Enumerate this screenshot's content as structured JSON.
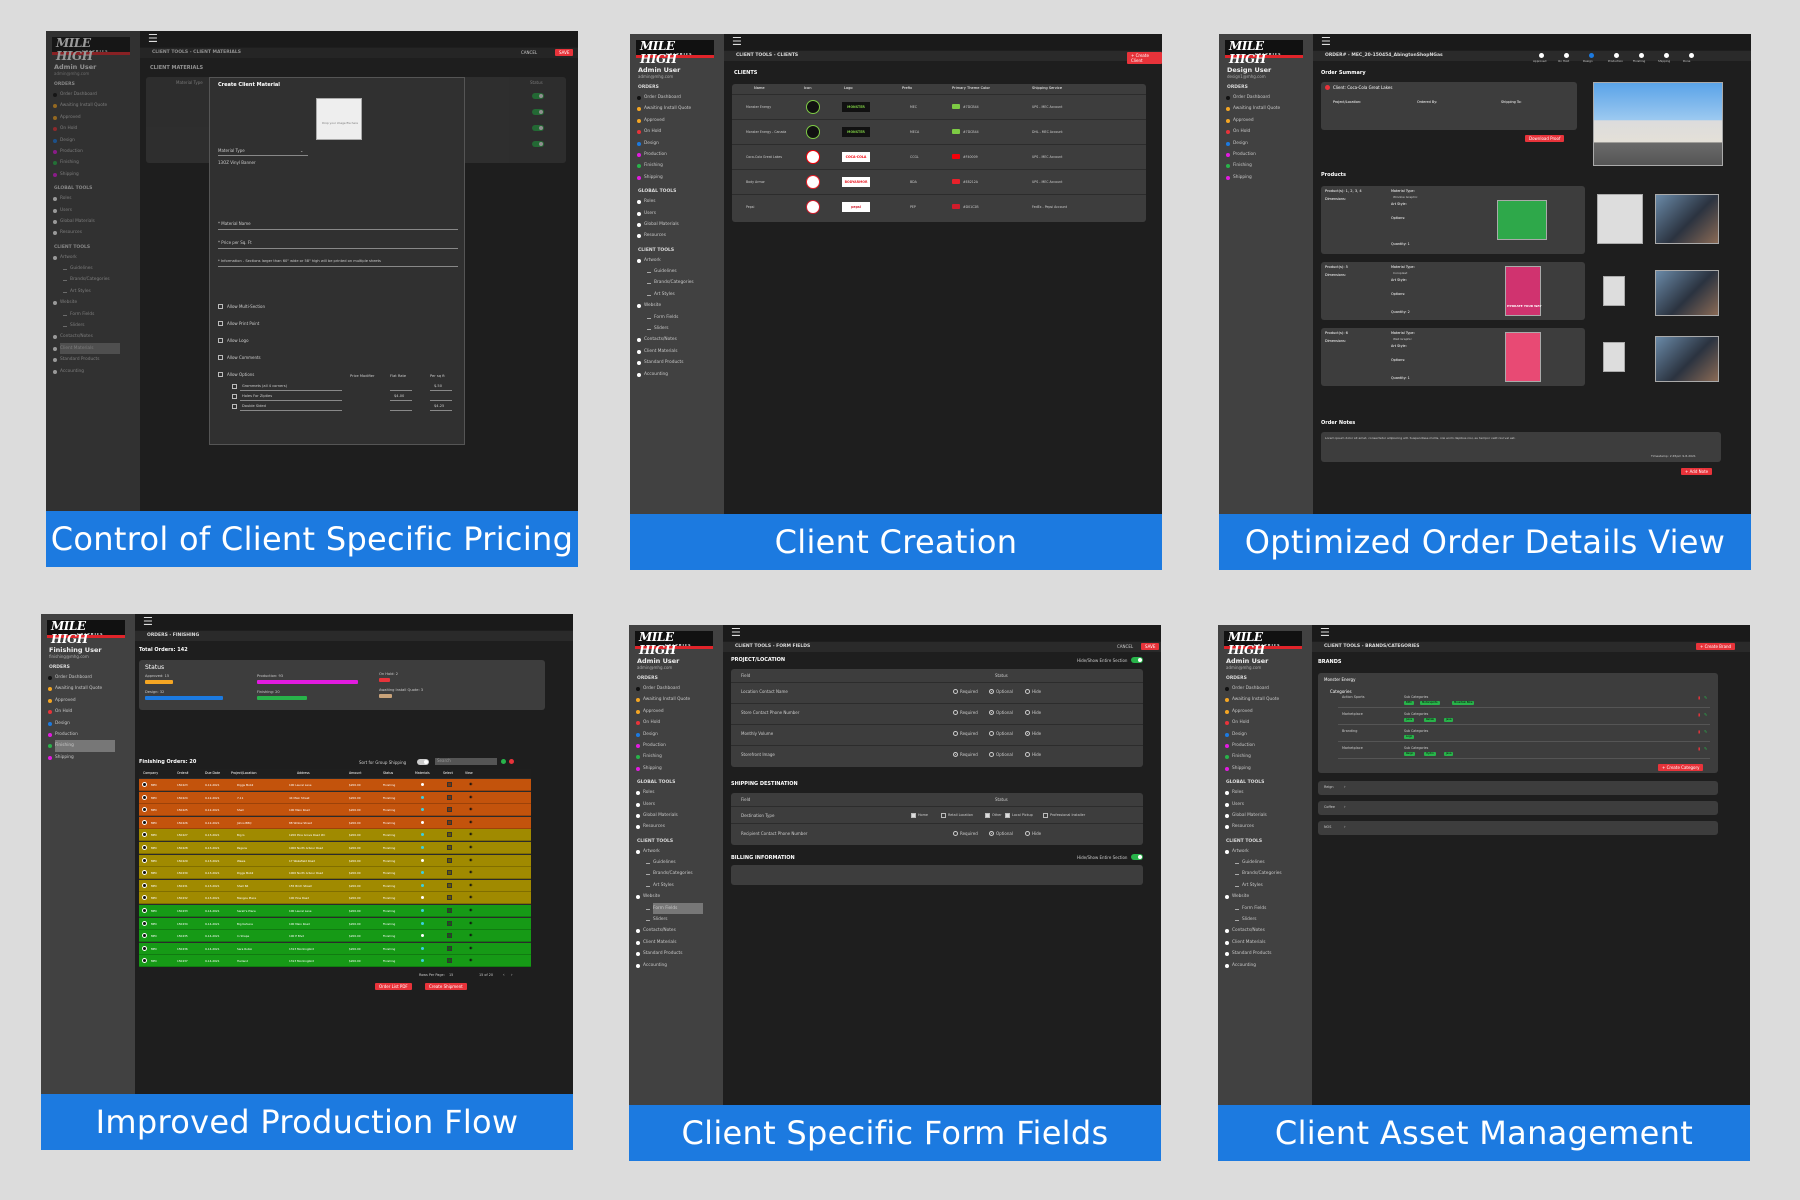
{
  "app": {
    "logo": "MILE HIGH",
    "logo_sub": "GRAPHICS",
    "admin_name": "Admin User",
    "admin_email": "admin@mhg.com",
    "design_name": "Design User",
    "design_email": "design1@mhg.com",
    "finishing_name": "Finishing User",
    "finishing_email": "finishing@mhg.com"
  },
  "nav": {
    "orders_header": "ORDERS",
    "order_items": [
      "Order Dashboard",
      "Awaiting Install Quote",
      "Approved",
      "On Hold",
      "Design",
      "Production",
      "Finishing",
      "Shipping"
    ],
    "global_header": "GLOBAL TOOLS",
    "global_items": [
      "Roles",
      "Users",
      "Global Materials",
      "Resources"
    ],
    "client_header": "CLIENT TOOLS",
    "client_items": [
      "Artwork",
      "Guidelines",
      "Brands/Categories",
      "Art Styles",
      "Website",
      "Form Fields",
      "Sliders",
      "Contacts/Notes",
      "Client Materials",
      "Standard Products",
      "Accounting"
    ]
  },
  "panels": {
    "p1": {
      "caption": "Control of Client Specific Pricing",
      "crumb": "CLIENT TOOLS - CLIENT MATERIALS",
      "cancel": "CANCEL",
      "save": "SAVE",
      "list_title": "CLIENT MATERIALS",
      "col_type": "Material Type",
      "col_status": "Status",
      "modal_title": "Create Client Material",
      "drop_hint": "Drop your image file here",
      "material_type_label": "Material Type",
      "material_type_value": "13OZ Vinyl Banner",
      "material_name": "* Material Name",
      "price": "* Price per Sq. Ft",
      "info": "* Information - Sections larger than 60\" wide or 58\" high will be printed on multiple sheets",
      "options": [
        "Allow Multi-Section",
        "Allow Print Point",
        "Allow Logo",
        "Allow Comments",
        "Allow Options"
      ],
      "opt_head_mod": "Price Modifier",
      "opt_head_flat": "Flat Rate",
      "opt_head_sqft": "Per sq ft",
      "opt_rows": [
        {
          "name": "Grommets (all 4 corners)",
          "flat": "",
          "sqft": "$.50"
        },
        {
          "name": "Holes For Zipties",
          "flat": "$4.00",
          "sqft": ""
        },
        {
          "name": "Double Sided",
          "flat": "",
          "sqft": "$4.25"
        }
      ]
    },
    "p2": {
      "caption": "Client Creation",
      "crumb": "CLIENT TOOLS - CLIENTS",
      "create_btn": "+ Create Client",
      "title": "CLIENTS",
      "headers": [
        "Name",
        "Icon",
        "Logo",
        "Prefix",
        "Primary Theme Color",
        "Shipping Service"
      ],
      "rows": [
        {
          "name": "Monster Energy",
          "logo": "MONSTER",
          "prefix": "MEC",
          "color": "#7DCB44",
          "hex": "#7DCB44",
          "ship": "UPS - MEC Account"
        },
        {
          "name": "Monster Energy - Canada",
          "logo": "MONSTER",
          "prefix": "MECA",
          "color": "#7DCB44",
          "hex": "#7DCB44",
          "ship": "DHL - MEC Account"
        },
        {
          "name": "Coca-Cola Great Lakes",
          "logo": "COCA-COLA",
          "prefix": "CCGL",
          "color": "#F40009",
          "hex": "#F40009",
          "ship": "UPS - MEC Account"
        },
        {
          "name": "Body Armor",
          "logo": "BODYARMOR",
          "prefix": "BDA",
          "color": "#E8212A",
          "hex": "#E8212A",
          "ship": "UPS - MEC Account"
        },
        {
          "name": "Pepsi",
          "logo": "pepsi",
          "prefix": "PEP",
          "color": "#D01C2B",
          "hex": "#D01C2B",
          "ship": "FedEx - Pepsi Account"
        }
      ]
    },
    "p3": {
      "caption": "Optimized Order Details View",
      "crumb": "ORDER# - MEC_20-150454_AbingtonShopNGas",
      "steps": [
        "Approved",
        "On Hold",
        "Design",
        "Production",
        "Finishing",
        "Shipping",
        "Done"
      ],
      "summary_title": "Order Summary",
      "client_label": "Client: Coca-Cola Great Lakes",
      "proj_label": "Project/Location:",
      "ordered_label": "Ordered By:",
      "ship_label": "Shipping To:",
      "download": "Download Proof",
      "products_title": "Products",
      "products": [
        {
          "title": "Product(s): 1, 2, 3, 4",
          "material": "Window Graphic",
          "qty": "Quantity: 1"
        },
        {
          "title": "Product(s): 5",
          "material": "Coroplast",
          "qty": "Quantity: 2"
        },
        {
          "title": "Product(s): 6",
          "material": "Wall Graphic",
          "qty": "Quantity: 1"
        }
      ],
      "dim_label": "Dimensions:",
      "mat_label": "Material Type:",
      "style_label": "Art Style:",
      "opt_label": "Options:",
      "hydrate": "HYDRATE YOUR WAY",
      "notes_title": "Order Notes",
      "notes_text": "Lorem ipsum dolor sit amet, consectetur adipiscing elit. Suspendisse mollis, nisi enim dapibus nisi, eu tempor velit nisl vel est.",
      "timestamp": "Timestamp: 2:45pm 9-8-2021",
      "add_note": "+ Add Note"
    },
    "p4": {
      "caption": "Improved Production Flow",
      "crumb": "ORDERS - FINISHING",
      "total": "Total Orders: 142",
      "status": "Status",
      "stat_items": [
        {
          "label": "Approved: 15",
          "fill": 0.25,
          "color": "#f5a623"
        },
        {
          "label": "Production: 93",
          "fill": 0.9,
          "color": "#e21be0"
        },
        {
          "label": "On Hold: 2",
          "fill": 0.1,
          "color": "#e8333a"
        },
        {
          "label": "Design: 32",
          "fill": 0.7,
          "color": "#1c7ae0"
        },
        {
          "label": "Finishing: 20",
          "fill": 0.45,
          "color": "#28b34a"
        },
        {
          "label": "Awaiting Install Quote: 3",
          "fill": 0.12,
          "color": "#c9a37a"
        }
      ],
      "finishing": "Finishing Orders: 20",
      "sort": "Sort for Group Shipping",
      "search": "Search",
      "headers": [
        "Company",
        "Order#",
        "Due Date",
        "Project/Location",
        "Address",
        "Amount",
        "Status",
        "Materials",
        "Select",
        "View"
      ],
      "rows": [
        {
          "order": "150423",
          "due": "9-12-2021",
          "proj": "Diggs Mobil",
          "addr": "100 Laurel Lane",
          "amt": "$200.00",
          "status": "Finishing",
          "band": "o"
        },
        {
          "order": "150424",
          "due": "9-12-2021",
          "proj": "7-11",
          "addr": "44 Main Street",
          "amt": "$200.00",
          "status": "Finishing",
          "band": "o"
        },
        {
          "order": "150425",
          "due": "9-12-2021",
          "proj": "Shell",
          "addr": "100 Main Road",
          "amt": "$200.00",
          "status": "Finishing",
          "band": "o"
        },
        {
          "order": "150426",
          "due": "9-12-2021",
          "proj": "Johns BBQ",
          "addr": "88 Willow Street",
          "amt": "$200.00",
          "status": "Finishing",
          "band": "o"
        },
        {
          "order": "150427",
          "due": "9-13-2021",
          "proj": "Big G",
          "addr": "1200 Pine Grove Road #C",
          "amt": "$200.00",
          "status": "Finishing",
          "band": "y"
        },
        {
          "order": "150428",
          "due": "9-13-2021",
          "proj": "Pagans",
          "addr": "1000 North Arbour Road",
          "amt": "$200.00",
          "status": "Finishing",
          "band": "y"
        },
        {
          "order": "150429",
          "due": "9-13-2021",
          "proj": "Wawa",
          "addr": "17 Wakefield Road",
          "amt": "$200.00",
          "status": "Finishing",
          "band": "y"
        },
        {
          "order": "150430",
          "due": "9-13-2021",
          "proj": "Diggs Mobil",
          "addr": "1000 North Arbour Road",
          "amt": "$200.00",
          "status": "Finishing",
          "band": "y"
        },
        {
          "order": "150431",
          "due": "9-13-2021",
          "proj": "Shell 66",
          "addr": "155 Birch Street",
          "amt": "$200.00",
          "status": "Finishing",
          "band": "y"
        },
        {
          "order": "150432",
          "due": "9-13-2021",
          "proj": "Mangos Place",
          "addr": "100 Pine Road",
          "amt": "$200.00",
          "status": "Finishing",
          "band": "y"
        },
        {
          "order": "150433",
          "due": "9-14-2021",
          "proj": "Sarah's Place",
          "addr": "100 Laurel Lane",
          "amt": "$200.00",
          "status": "Finishing",
          "band": "g"
        },
        {
          "order": "150434",
          "due": "9-14-2021",
          "proj": "Big Kahuna",
          "addr": "100 Main Road",
          "amt": "$200.00",
          "status": "Finishing",
          "band": "g"
        },
        {
          "order": "150435",
          "due": "9-14-2021",
          "proj": "In Shape",
          "addr": "100 E Blvd",
          "amt": "$200.00",
          "status": "Finishing",
          "band": "g"
        },
        {
          "order": "150436",
          "due": "9-14-2021",
          "proj": "Sara Rubio",
          "addr": "1313 Mockingbird",
          "amt": "$200.00",
          "status": "Finishing",
          "band": "g"
        },
        {
          "order": "150437",
          "due": "9-14-2021",
          "proj": "Harland",
          "addr": "1313 Mockingbird",
          "amt": "$200.00",
          "status": "Finishing",
          "band": "g"
        }
      ],
      "company": "MEC",
      "rows_per_page": "Rows Per Page:",
      "rows_count": "15",
      "page_info": "15 of 20",
      "order_list_btn": "Order List PDF",
      "shipment_btn": "Create Shipment"
    },
    "p5": {
      "caption": "Client Specific Form Fields",
      "crumb": "CLIENT TOOLS - FORM FIELDS",
      "cancel": "CANCEL",
      "save": "SAVE",
      "sec1": "PROJECT/LOCATION",
      "sec2": "SHIPPING DESTINATION",
      "sec3": "BILLING INFORMATION",
      "hide_show": "Hide/Show Entire Section",
      "field_h": "Field",
      "status_h": "Status",
      "opt_req": "Required",
      "opt_opt": "Optional",
      "opt_hide": "Hide",
      "proj_fields": [
        {
          "name": "Location Contact Name",
          "sel": 1
        },
        {
          "name": "Store Contact Phone Number",
          "sel": 1
        },
        {
          "name": "Monthly Volume",
          "sel": 2
        },
        {
          "name": "Storefront Image",
          "sel": 0
        }
      ],
      "dest_type": "Destination Type",
      "dest_opts": [
        {
          "label": "Home",
          "on": true
        },
        {
          "label": "Retail Location",
          "on": false
        },
        {
          "label": "Other",
          "on": true
        },
        {
          "label": "Local Pickup",
          "on": true
        },
        {
          "label": "Professional Installer",
          "on": false
        }
      ],
      "recipient": "Recipient Contact Phone Number"
    },
    "p6": {
      "caption": "Client Asset Management",
      "crumb": "CLIENT TOOLS - BRANDS/CATEGORIES",
      "create_btn": "+ Create Brand",
      "title": "BRANDS",
      "brand": "Monster Energy",
      "categories": "Categories",
      "sub_label": "Sub Categories",
      "cats": [
        {
          "name": "Action Sports",
          "tags": [
            "BMX",
            "Motorsports",
            "Mountain Bike"
          ]
        },
        {
          "name": "Marketplace",
          "tags": [
            "Juice",
            "Rehab",
            "Java"
          ]
        },
        {
          "name": "Branding",
          "tags": [
            "Logo"
          ]
        },
        {
          "name": "Marketplace",
          "tags": [
            "Reign",
            "Hydro",
            "Java"
          ]
        }
      ],
      "create_cat": "+ Create Category",
      "collapsed": [
        "Reign",
        "Coffee",
        "NOS"
      ]
    }
  }
}
